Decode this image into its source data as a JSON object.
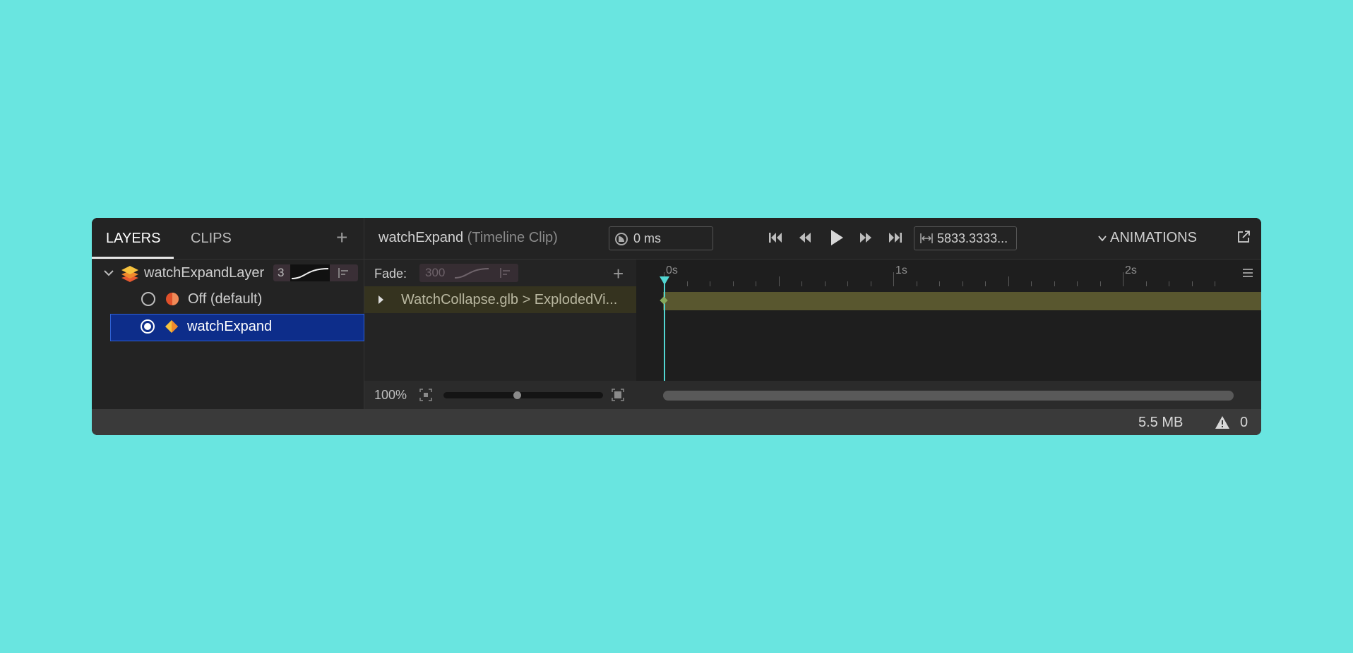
{
  "tabs": {
    "layers": "LAYERS",
    "clips": "CLIPS"
  },
  "layer": {
    "name": "watchExpandLayer",
    "weight": "3"
  },
  "clips": [
    {
      "name": "Off (default)",
      "selected": false,
      "icon": "half-circle-icon"
    },
    {
      "name": "watchExpand",
      "selected": true,
      "icon": "diamond-icon"
    }
  ],
  "toolbar": {
    "clip_name": "watchExpand",
    "clip_type": "(Timeline Clip)",
    "time": "0 ms",
    "length": "5833.3333...",
    "animations_label": "ANIMATIONS"
  },
  "track": {
    "fade_label": "Fade:",
    "fade_value": "300",
    "name": "WatchCollapse.glb > ExplodedVi..."
  },
  "ruler": {
    "labels": [
      "0s",
      "1s",
      "2s"
    ]
  },
  "zoom": {
    "percent": "100%",
    "level": 0.46
  },
  "status": {
    "memory": "5.5 MB",
    "warnings": "0"
  },
  "colors": {
    "background": "#69e5e0",
    "panel": "#1e1e1e",
    "selection": "#0d2d8a",
    "playhead": "#52d6d2",
    "clip_bar": "#59572f"
  }
}
